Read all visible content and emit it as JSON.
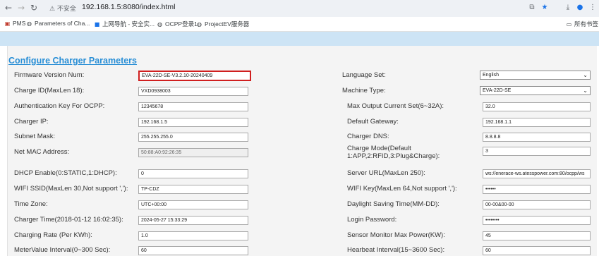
{
  "browser": {
    "warning": "⚠ 不安全",
    "url": "192.168.1.5:8080/index.html",
    "bookmarks": [
      {
        "label": "PMS"
      },
      {
        "label": "Parameters of Cha..."
      },
      {
        "label": "上网导航 - 安全实..."
      },
      {
        "label": "OCPP登录1"
      },
      {
        "label": "ProjectEV服务器"
      }
    ],
    "all_bookmarks": "所有书签"
  },
  "page": {
    "title": "Configure Charger Parameters"
  },
  "left": [
    {
      "label": "Firmware Version Num:",
      "value": "EVA-22D-SE-V3.2.10-20240409"
    },
    {
      "label": "Charge ID(MaxLen 18):",
      "value": "VXD0938003"
    },
    {
      "label": "Authentication Key For OCPP:",
      "value": "12345678"
    },
    {
      "label": "Charger IP:",
      "value": "192.168.1.5"
    },
    {
      "label": "Subnet Mask:",
      "value": "255.255.255.0"
    },
    {
      "label": "Net MAC Address:",
      "value": "50:88:A0:92:26:35"
    },
    {
      "label": "DHCP Enable(0:STATIC,1:DHCP):",
      "value": "0"
    },
    {
      "label": "WIFI SSID(MaxLen 30,Not support ','):",
      "value": "TP-CDZ"
    },
    {
      "label": "Time Zone:",
      "value": "UTC+00:00"
    },
    {
      "label": "Charger Time(2018-01-12 16:02:35):",
      "value": "2024-05-27 15:33:29"
    },
    {
      "label": "Charging Rate (Per KWh):",
      "value": "1.0"
    },
    {
      "label": "MeterValue Interval(0~300 Sec):",
      "value": "60"
    }
  ],
  "right": [
    {
      "label": "Language Set:",
      "value": "English"
    },
    {
      "label": "Machine Type:",
      "value": "EVA-22D-SE"
    },
    {
      "label": "Max Output Current Set(6~32A):",
      "value": "32.0"
    },
    {
      "label": "Default Gateway:",
      "value": "192.168.1.1"
    },
    {
      "label": "Charger DNS:",
      "value": "8.8.8.8"
    },
    {
      "label": "Charge Mode(Default",
      "label2": "1:APP,2:RFID,3:Plug&Charge):",
      "value": "3"
    },
    {
      "label": "Server URL(MaxLen 250):",
      "value": "ws://enerace-ws.atesspower.com:80/ocpp/ws"
    },
    {
      "label": "WIFI Key(MaxLen 64,Not support ','):",
      "value": "••••••"
    },
    {
      "label": "Daylight Saving Time(MM-DD):",
      "value": "00-00&00-00"
    },
    {
      "label": "Login Password:",
      "value": "••••••••"
    },
    {
      "label": "Sensor Monitor Max Power(KW):",
      "value": "45"
    },
    {
      "label": "Hearbeat Interval(15~3600 Sec):",
      "value": "60"
    }
  ]
}
